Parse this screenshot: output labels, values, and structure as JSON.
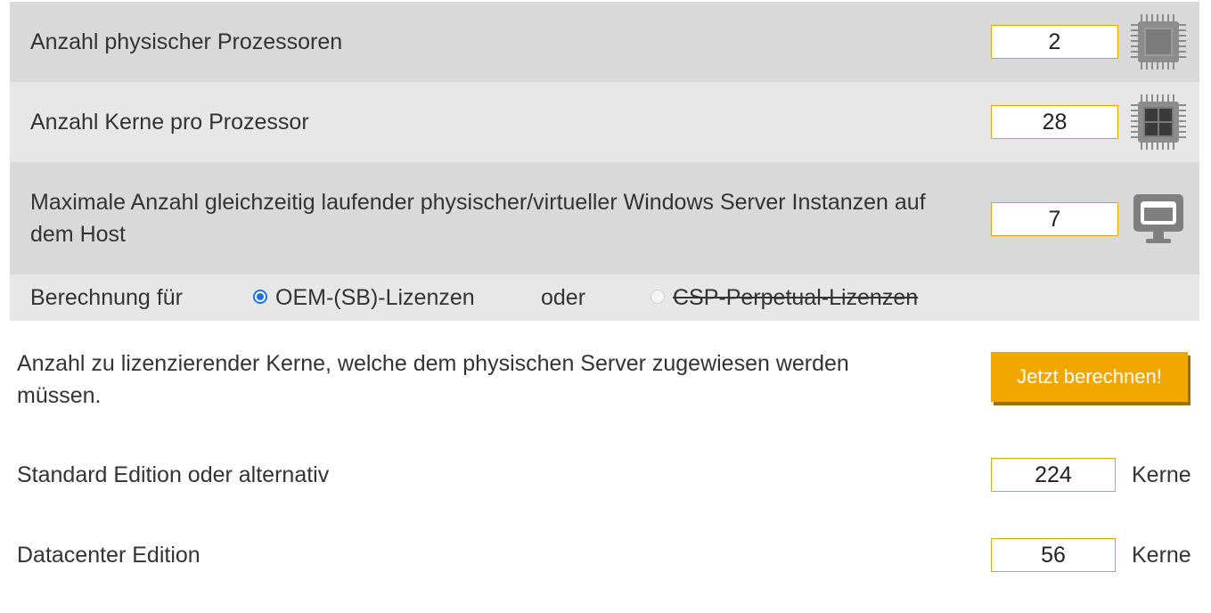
{
  "inputs": {
    "processors": {
      "label": "Anzahl physischer Prozessoren",
      "value": "2",
      "icon": "cpu-chip-icon"
    },
    "cores": {
      "label": "Anzahl Kerne pro Prozessor",
      "value": "28",
      "icon": "multicore-chip-icon"
    },
    "instances": {
      "label": "Maximale Anzahl gleichzeitig laufender physischer/virtueller Windows Server Instanzen auf dem Host",
      "value": "7",
      "icon": "monitor-icon"
    }
  },
  "calculation": {
    "label": "Berechnung für",
    "option_oem": "OEM-(SB)-Lizenzen",
    "connector": "oder",
    "option_csp": "CSP-Perpetual-Lizenzen",
    "selected": "oem"
  },
  "result_intro": "Anzahl zu lizenzierender Kerne, welche dem physischen Server zugewiesen werden müssen.",
  "calc_button": "Jetzt berechnen!",
  "results": {
    "standard": {
      "label": "Standard Edition oder alternativ",
      "value": "224",
      "unit": "Kerne"
    },
    "datacenter": {
      "label": "Datacenter Edition",
      "value": "56",
      "unit": "Kerne"
    }
  },
  "colors": {
    "accent": "#f2a600",
    "input_border": "#e8a400",
    "radio": "#1a73e8"
  }
}
